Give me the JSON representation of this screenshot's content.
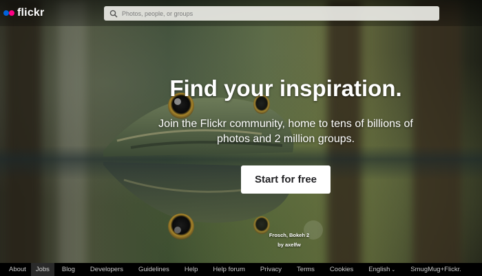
{
  "header": {
    "logo_text": "flickr",
    "search_placeholder": "Photos, people, or groups"
  },
  "hero": {
    "title": "Find your inspiration.",
    "subtitle": "Join the Flickr community, home to tens of billions of photos and 2 million groups.",
    "cta_label": "Start for free"
  },
  "photo_credit": {
    "title": "Frosch, Bokeh 2",
    "author": "by axelfw"
  },
  "footer": {
    "links": [
      "About",
      "Jobs",
      "Blog",
      "Developers",
      "Guidelines",
      "Help",
      "Help forum",
      "Privacy",
      "Terms",
      "Cookies",
      "English",
      "SmugMug+Flickr."
    ],
    "chevron": "⌄"
  },
  "colors": {
    "flickr_blue": "#0063dc",
    "flickr_pink": "#ff0084",
    "footer_bg": "#000000"
  }
}
